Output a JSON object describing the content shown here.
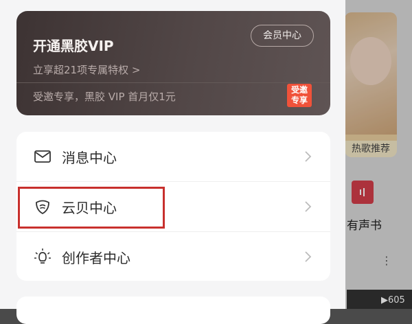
{
  "background_app": {
    "hot_label": "热歌推荐",
    "book_label": "有声书",
    "more_label": "⋮",
    "play_count": "▶605"
  },
  "vip": {
    "title": "开通黑胶VIP",
    "subtitle": "立享超21项专属特权 >",
    "member_center_label": "会员中心",
    "promo_text": "受邀专享，黑胶 VIP 首月仅1元",
    "badge_line1": "受邀",
    "badge_line2": "专享",
    "colors": {
      "card_dark": "#3d3333",
      "badge": "#f0523a"
    }
  },
  "menu": {
    "items": [
      {
        "label": "消息中心",
        "icon": "mail-icon"
      },
      {
        "label": "云贝中心",
        "icon": "cloud-shell-icon"
      },
      {
        "label": "创作者中心",
        "icon": "lightbulb-icon"
      }
    ]
  },
  "highlight_color": "#c8302d"
}
